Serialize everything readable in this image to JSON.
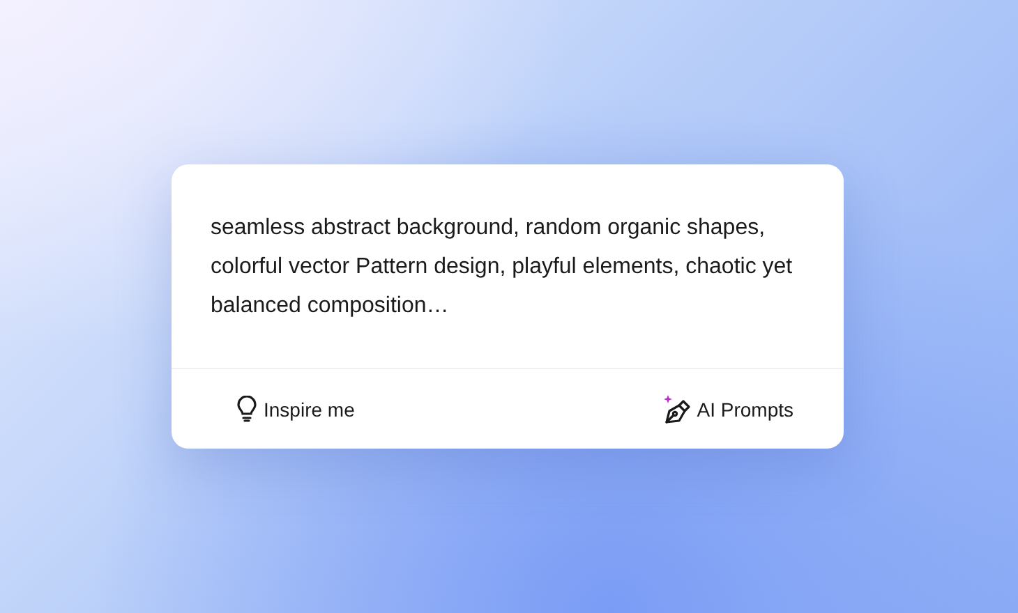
{
  "prompt": {
    "text": "seamless abstract background, random organic shapes, colorful vector Pattern design, playful elements, chaotic yet balanced composition…"
  },
  "actions": [
    {
      "kind": "inspire",
      "label": "Inspire me"
    },
    {
      "kind": "ai",
      "label": "AI Prompts"
    }
  ]
}
